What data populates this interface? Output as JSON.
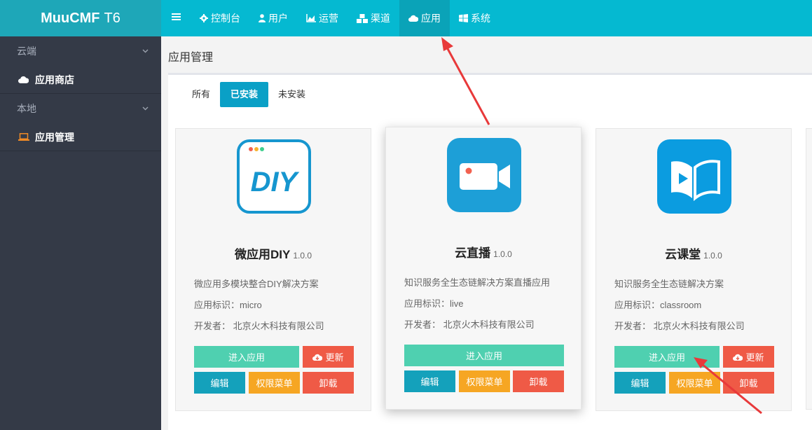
{
  "brand": {
    "name": "MuuCMF",
    "version": "T6"
  },
  "topnav": [
    {
      "label": "",
      "icon": "menu-icon"
    },
    {
      "label": "控制台",
      "icon": "gear-icon"
    },
    {
      "label": "用户",
      "icon": "user-icon"
    },
    {
      "label": "运营",
      "icon": "area-chart-icon"
    },
    {
      "label": "渠道",
      "icon": "cubes-icon"
    },
    {
      "label": "应用",
      "icon": "cloud-icon",
      "active": true
    },
    {
      "label": "系统",
      "icon": "windows-icon"
    }
  ],
  "sidebar": {
    "groups": [
      {
        "label": "云端",
        "items": [
          {
            "label": "应用商店",
            "icon": "cloud-icon"
          }
        ]
      },
      {
        "label": "本地",
        "items": [
          {
            "label": "应用管理",
            "icon": "laptop-icon",
            "active": true
          }
        ]
      }
    ]
  },
  "page": {
    "title": "应用管理"
  },
  "tabs": [
    {
      "label": "所有"
    },
    {
      "label": "已安装",
      "active": true
    },
    {
      "label": "未安装"
    }
  ],
  "cards": [
    {
      "name": "微应用DIY",
      "version": "1.0.0",
      "description": "微应用多模块整合DIY解决方案",
      "identifier": "应用标识：micro",
      "developer": "开发者：  北京火木科技有限公司",
      "icon": "diy-icon",
      "enter_label": "进入应用",
      "update_label": "更新",
      "edit_label": "编辑",
      "perm_label": "权限菜单",
      "uninstall_label": "卸载"
    },
    {
      "name": "云直播",
      "version": "1.0.0",
      "description": "知识服务全生态链解决方案直播应用",
      "identifier": "应用标识：live",
      "developer": "开发者：  北京火木科技有限公司",
      "icon": "video-camera-icon",
      "enter_label": "进入应用",
      "edit_label": "编辑",
      "perm_label": "权限菜单",
      "uninstall_label": "卸载"
    },
    {
      "name": "云课堂",
      "version": "1.0.0",
      "description": "知识服务全生态链解决方案",
      "identifier": "应用标识：classroom",
      "developer": "开发者：  北京火木科技有限公司",
      "icon": "book-play-icon",
      "enter_label": "进入应用",
      "update_label": "更新",
      "edit_label": "编辑",
      "perm_label": "权限菜单",
      "uninstall_label": "卸载"
    }
  ],
  "colors": {
    "topbar": "#05b9d1",
    "brand_bg": "#1ea7b8",
    "sidebar": "#343a47",
    "green_btn": "#4fd0b0",
    "red_btn": "#ef5a46",
    "teal_btn": "#14a1bb",
    "orange_btn": "#f6a623",
    "annotation_arrow": "#e8393a"
  }
}
